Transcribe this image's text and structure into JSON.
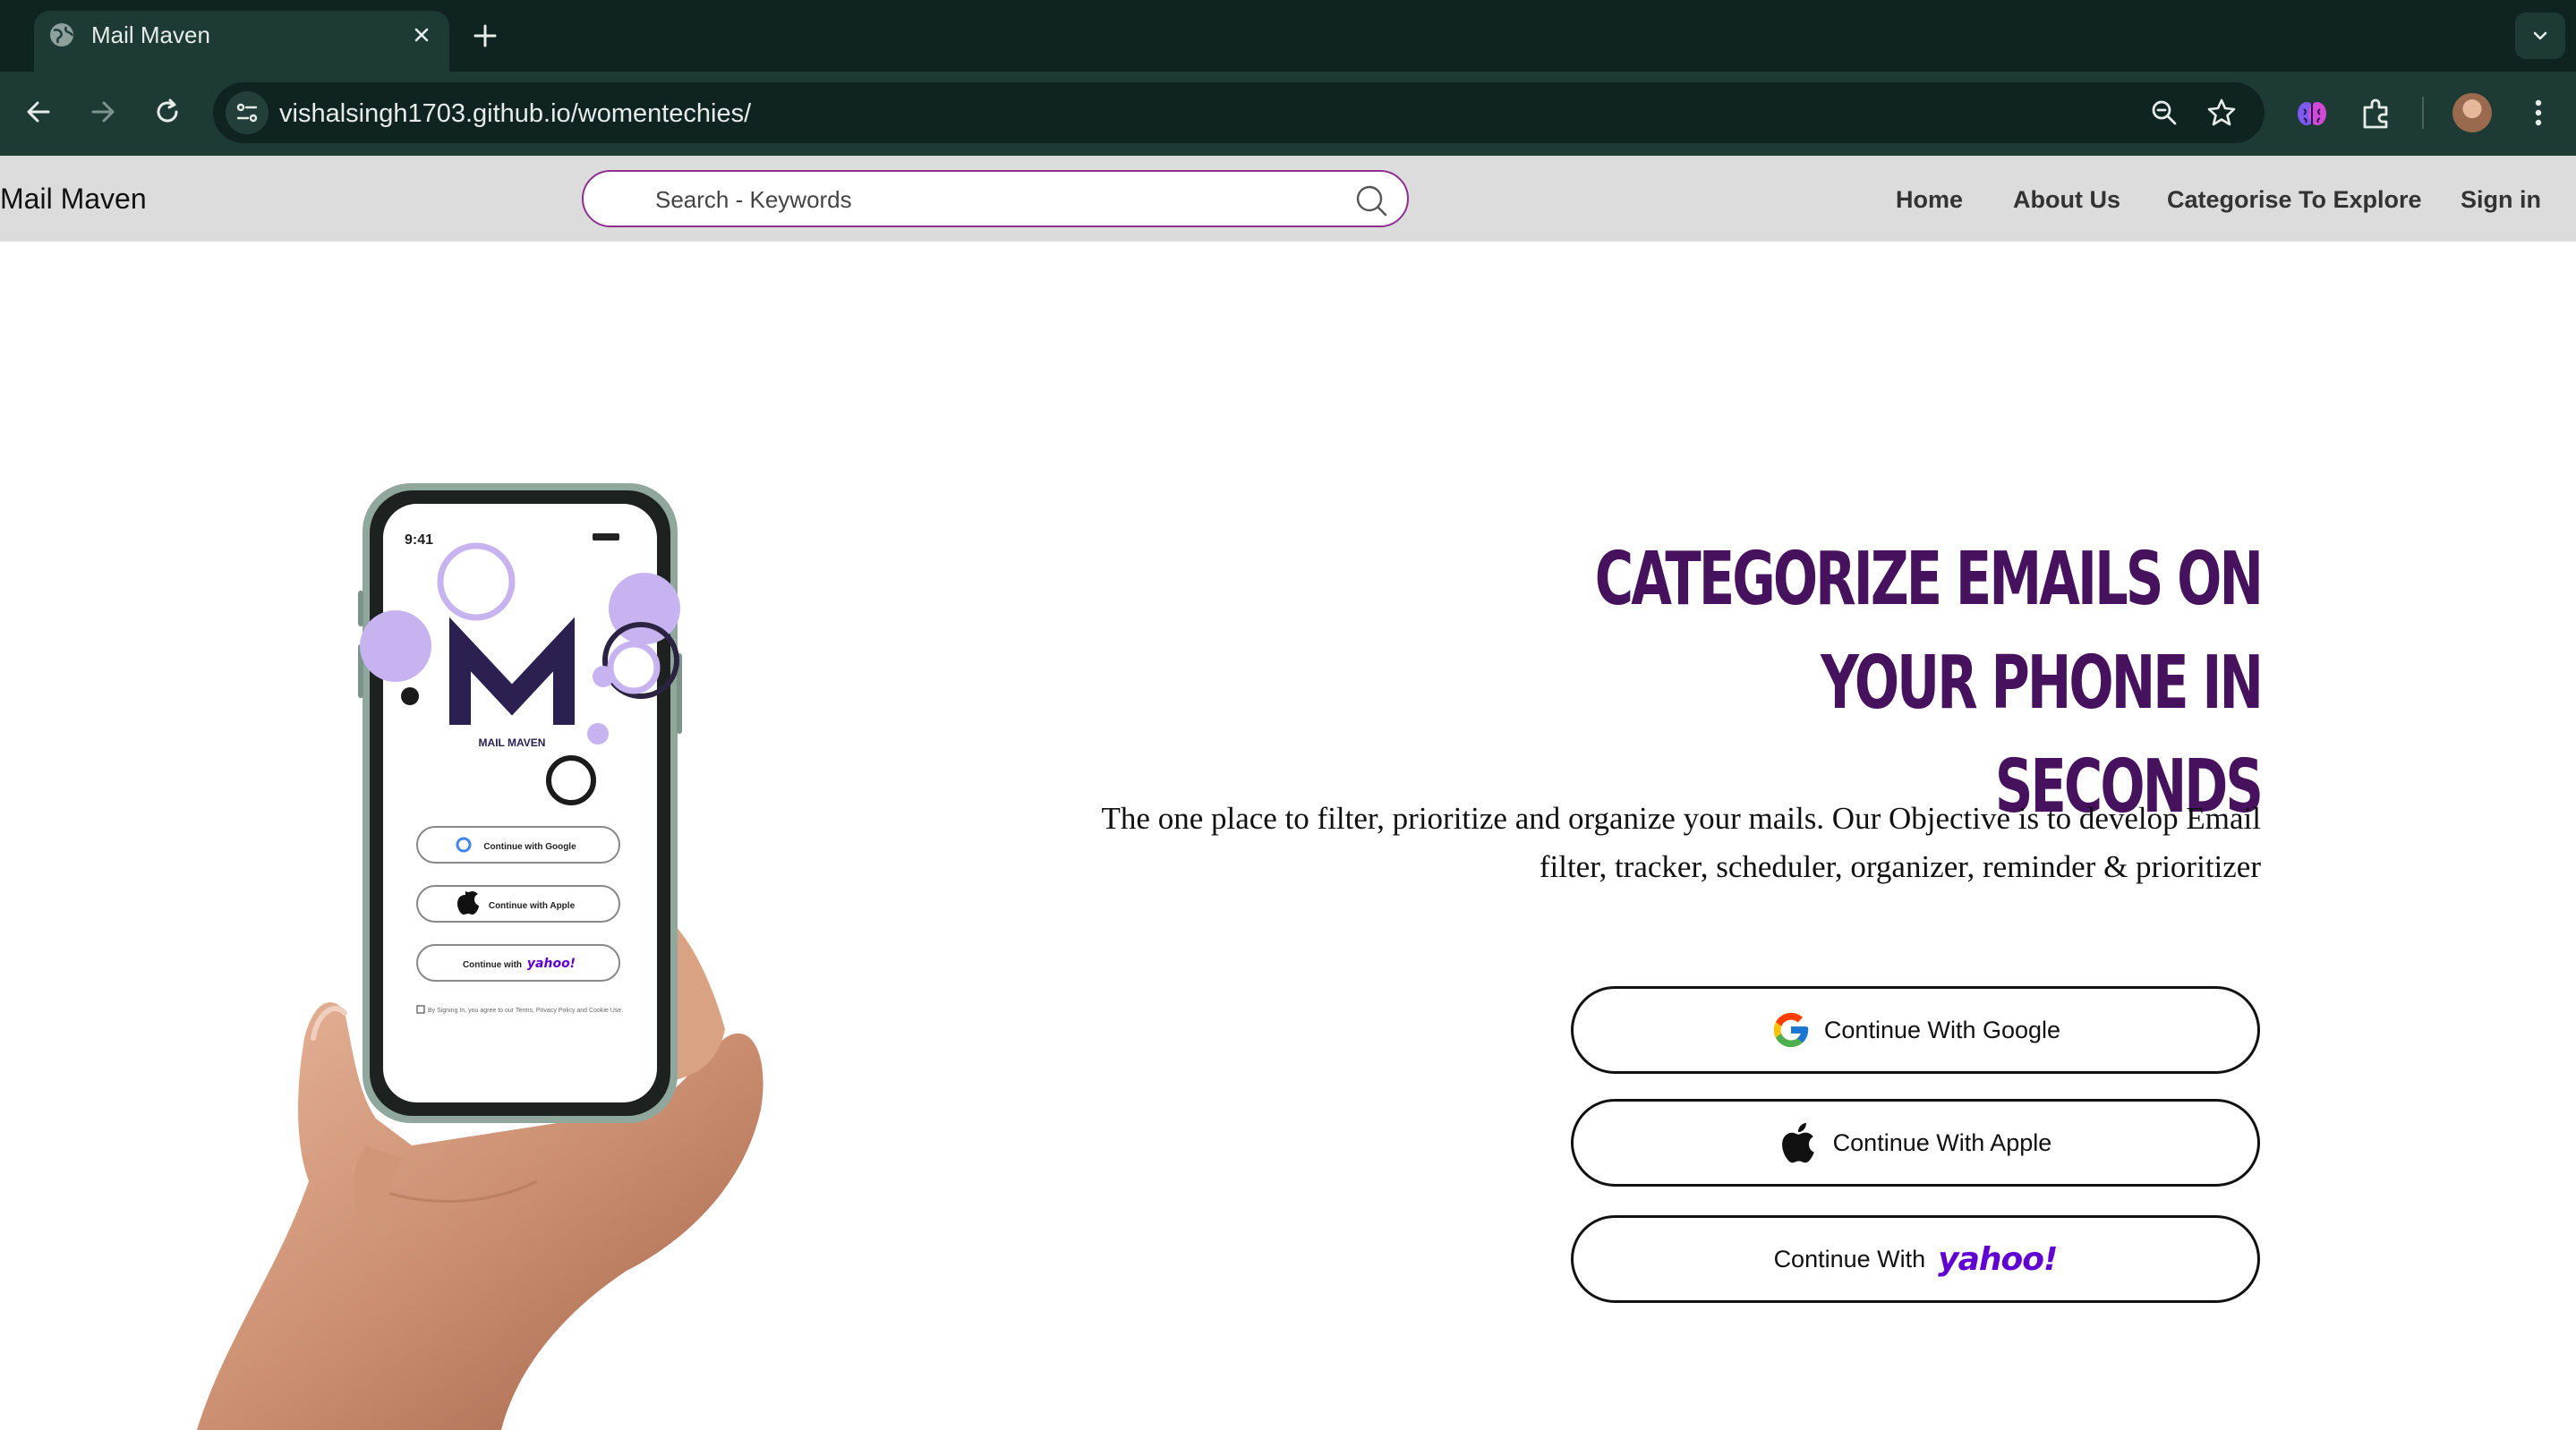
{
  "browser": {
    "tab": {
      "title": "Mail Maven",
      "favicon": "globe-icon",
      "close_icon": "close-icon"
    },
    "new_tab_icon": "plus-icon",
    "tab_menu_icon": "chevron-down-icon",
    "url": {
      "host": "vishalsingh1703.github.io",
      "path": "/womentechies/"
    },
    "toolbar_icons": [
      "back-icon",
      "forward-icon",
      "reload-icon",
      "site-info-icon",
      "zoom-icon",
      "bookmark-star-icon",
      "extension-brain-icon",
      "extensions-puzzle-icon",
      "profile-avatar",
      "more-menu-icon"
    ],
    "colors": {
      "tabstrip": "#0f2320",
      "toolbar": "#1e3a34",
      "omnibox": "#0f2320"
    }
  },
  "site": {
    "brand": "Mail Maven",
    "search": {
      "placeholder": "Search - Keywords",
      "value": ""
    },
    "nav": [
      "Home",
      "About Us",
      "Categorise To Explore",
      "Sign in"
    ],
    "colors": {
      "nav_bg": "#dcdcdc",
      "search_border": "#8e2f8f",
      "accent": "#46125e"
    }
  },
  "hero": {
    "headline_line1": "Categorize emails on your phone in",
    "headline_line2": "seconds",
    "tagline_line1": "The one place to filter, prioritize and organize your mails. Our Objective is to develop Email",
    "tagline_line2": "filter, tracker, scheduler, organizer, reminder & prioritizer",
    "buttons": {
      "google": {
        "label": "Continue With Google",
        "icon": "google-icon"
      },
      "apple": {
        "label": "Continue With Apple",
        "icon": "apple-icon"
      },
      "yahoo": {
        "label": "Continue With",
        "logo_text": "yahoo!"
      }
    },
    "phone_mockup": {
      "status_time": "9:41",
      "app_name": "MAIL MAVEN",
      "logo_letter": "M",
      "buttons": [
        "Continue with Google",
        "Continue with Apple",
        "Continue with"
      ],
      "yahoo_text": "yahoo!",
      "legal": "By Signing In, you agree to our Terms, Privacy Policy and Cookie Use."
    }
  }
}
